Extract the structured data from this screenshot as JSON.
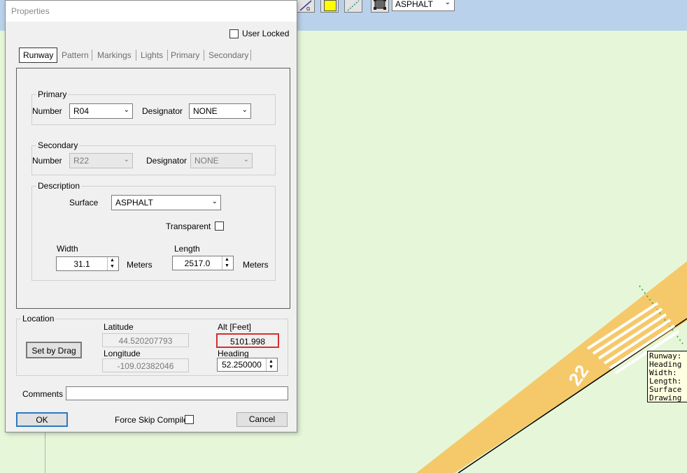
{
  "toolbar": {
    "surface_value": "ASPHALT"
  },
  "dialog": {
    "title": "Properties",
    "user_locked_label": "User Locked",
    "tabs": [
      "Runway",
      "Pattern",
      "Markings",
      "Lights",
      "Primary",
      "Secondary"
    ],
    "primary": {
      "group_title": "Primary",
      "number_label": "Number",
      "number_value": "R04",
      "designator_label": "Designator",
      "designator_value": "NONE"
    },
    "secondary": {
      "group_title": "Secondary",
      "number_label": "Number",
      "number_value": "R22",
      "designator_label": "Designator",
      "designator_value": "NONE"
    },
    "description": {
      "group_title": "Description",
      "surface_label": "Surface",
      "surface_value": "ASPHALT",
      "transparent_label": "Transparent",
      "width_label": "Width",
      "width_value": "31.1",
      "width_unit": "Meters",
      "length_label": "Length",
      "length_value": "2517.0",
      "length_unit": "Meters"
    },
    "location": {
      "group_title": "Location",
      "set_by_drag_label": "Set by Drag",
      "latitude_label": "Latitude",
      "latitude_value": "44.520207793",
      "longitude_label": "Longitude",
      "longitude_value": "-109.02382046",
      "alt_label": "Alt [Feet]",
      "alt_value": "5101.998",
      "heading_label": "Heading",
      "heading_value": "52.250000"
    },
    "comments_label": "Comments",
    "comments_value": "",
    "ok_label": "OK",
    "force_skip_label": "Force Skip Compile",
    "cancel_label": "Cancel"
  },
  "map": {
    "runway_number": "22",
    "tooltip_lines": [
      "Runway:",
      "Heading",
      "Width:",
      "Length:",
      "Surface",
      "Drawing"
    ]
  },
  "colors": {
    "background": "#e6f7d9",
    "toolbar": "#b9d1ea",
    "runway": "#f5c96a",
    "highlight": "#d32f2f",
    "ok_border": "#2b78c2"
  }
}
